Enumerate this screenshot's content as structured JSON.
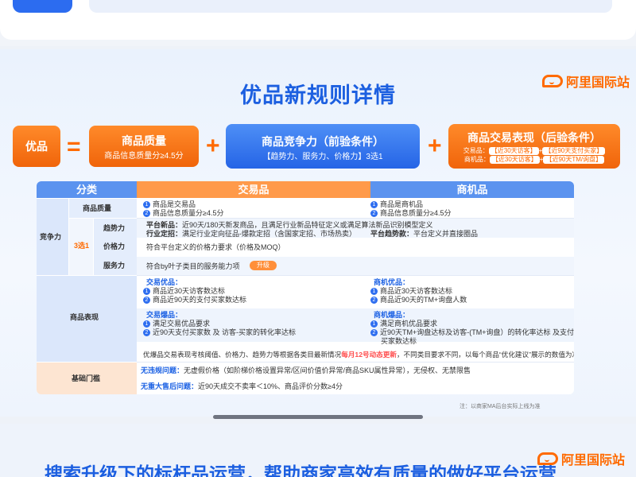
{
  "header": {
    "title": "优品新规则详情",
    "logo_text": "阿里国际站"
  },
  "formula": {
    "result": "优品",
    "equals": "=",
    "plus": "+",
    "quality": {
      "title": "商品质量",
      "sub": "商品信息质量分≥4.5分"
    },
    "competitiveness": {
      "title": "商品竞争力（前验条件）",
      "sub": "【趋势力、服务力、价格力】3选1"
    },
    "trade": {
      "title": "商品交易表现（后验条件）",
      "line1_label": "交易品：",
      "line1_a": "【近30天访客】",
      "line1_plus": "+",
      "line1_b": "【近90天支付买家】",
      "line2_label": "商机品：",
      "line2_a": "【近30天访客】",
      "line2_plus": "+",
      "line2_b": "【近90天TM/询盘】"
    }
  },
  "table": {
    "headers": {
      "category": "分类",
      "trade_goods": "交易品",
      "opportunity_goods": "商机品"
    },
    "competitiveness": {
      "label": "竞争力",
      "quality_label": "商品质量",
      "pick": "3选1",
      "trend_label": "趋势力",
      "price_label": "价格力",
      "service_label": "服务力",
      "quality_trade_1": "商品是交易品",
      "quality_trade_2": "商品信息质量分≥4.5分",
      "quality_opp_1": "商品是商机品",
      "quality_opp_2": "商品信息质量分≥4.5分",
      "trend_line1_label": "平台新品：",
      "trend_line1": "近90天/180天新发商品，且满足行业新品特征定义或满足算法新品识别模型定义",
      "trend_line2_label": "行业定招：",
      "trend_line2": "满足行业定向征品-爆款定招（含国家定招、市场热卖）",
      "trend_platform_label": "平台趋势款：",
      "trend_platform": "平台定义并直接圈品",
      "price_text": "符合平台定义的价格力要求（价格及MOQ）",
      "service_text": "符合by叶子类目的服务能力项",
      "upgrade_badge": "升级"
    },
    "performance": {
      "label": "商品表现",
      "trade_good_title": "交易优品：",
      "trade_good_1": "商品近30天访客数达标",
      "trade_good_2": "商品近90天的支付买家数达标",
      "opp_good_title": "商机优品：",
      "opp_good_1": "商品近30天访客数达标",
      "opp_good_2": "商品近90天的TM+询盘人数",
      "trade_hot_title": "交易爆品：",
      "trade_hot_1": "满足交易优品要求",
      "trade_hot_2": "近90天支付买家数 及 访客-买家的转化率达标",
      "opp_hot_title": "商机爆品：",
      "opp_hot_1": "满足商机优品要求",
      "opp_hot_2": "近90天TM+询盘达标及访客-(TM+询盘）的转化率达标 及支付",
      "opp_hot_3": "买家数达标",
      "note_before": "优爆品交易表现考核阈值、价格力、趋势力等根据各类目最新情况",
      "note_highlight": "每月12号动态更新",
      "note_after": "，不同类目要求不同，以每个商品“优化建议”展示的数值为准"
    },
    "baseline": {
      "label": "基础门槛",
      "violation_title": "无违规问题：",
      "violation_text": "无虚假价格（如阶梯价格设置异常/区间价值价异常/商品SKU属性异常），无侵权、无禁限售",
      "aftersale_title": "无重大售后问题：",
      "aftersale_text": "近90天成交不卖率＜10%、商品评价分数≥4分"
    },
    "footnote": "注：以商家MA后台实际上线为准"
  },
  "bottom": {
    "title": "搜索升级下的标杆品运营，帮助商家高效有质量的做好平台运营",
    "logo_text": "阿里国际站"
  },
  "colors": {
    "brand_blue": "#1c5fe0",
    "brand_orange": "#ff6a00"
  }
}
